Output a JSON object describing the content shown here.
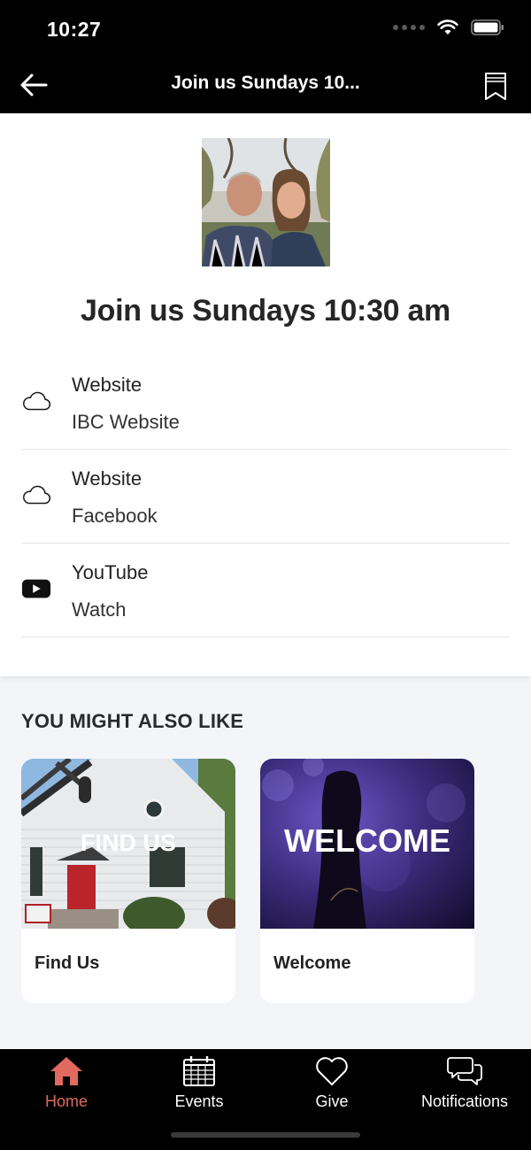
{
  "status_bar": {
    "time": "10:27"
  },
  "nav": {
    "title": "Join us Sundays 10..."
  },
  "page": {
    "title": "Join us Sundays 10:30 am"
  },
  "links": [
    {
      "type": "Website",
      "title": "IBC Website",
      "icon": "cloud-icon"
    },
    {
      "type": "Website",
      "title": "Facebook",
      "icon": "cloud-icon"
    },
    {
      "type": "YouTube",
      "title": "Watch",
      "icon": "youtube-icon"
    }
  ],
  "related": {
    "heading": "YOU MIGHT ALSO LIKE",
    "items": [
      {
        "title": "Find Us",
        "overlay": "FIND US"
      },
      {
        "title": "Welcome",
        "overlay": "WELCOME"
      }
    ]
  },
  "tabs": [
    {
      "label": "Home",
      "icon": "home-icon",
      "active": true
    },
    {
      "label": "Events",
      "icon": "calendar-icon",
      "active": false
    },
    {
      "label": "Give",
      "icon": "heart-icon",
      "active": false
    },
    {
      "label": "Notifications",
      "icon": "chat-bubbles-icon",
      "active": false
    }
  ],
  "colors": {
    "bar_bg": "#000000",
    "active_tab": "#e06a60",
    "page_bg": "#f3f5f9"
  }
}
